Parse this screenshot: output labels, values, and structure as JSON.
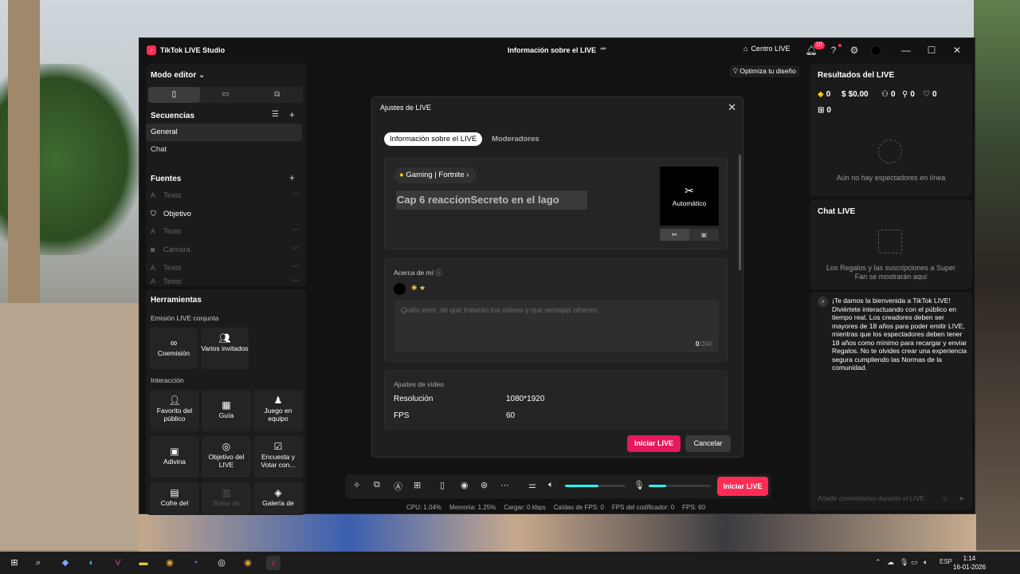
{
  "window": {
    "app_title": "TikTok LIVE Studio",
    "center_title": "Información sobre el LIVE",
    "centro_live": "Centro LIVE",
    "notif_count": "10"
  },
  "left": {
    "mode_editor": "Modo editor",
    "sequences_title": "Secuencias",
    "sequences": [
      "General",
      "Chat"
    ],
    "sources_title": "Fuentes",
    "sources": [
      "Texto",
      "Objetivo",
      "Texto",
      "Cámara",
      "Texto",
      "Texto"
    ],
    "tools_title": "Herramientas",
    "joint_title": "Emisión LIVE conjunta",
    "joint_tools": [
      "Coemisión",
      "Varios invitados"
    ],
    "interaction_title": "Interacción",
    "interaction_tools": [
      "Favorito del público",
      "Guía",
      "Juego en equipo",
      "Adivina",
      "Objetivo del LIVE",
      "Encuesta y Votar con...",
      "Cofre del",
      "Bolsa de",
      "Galería de"
    ]
  },
  "optimiza": "Optimiza tu diseño",
  "results": {
    "title": "Resultados del LIVE",
    "stats": [
      "0",
      "$0.00",
      "0",
      "0",
      "0",
      "0"
    ],
    "empty_text": "Aún no hay espectadores en línea"
  },
  "chat": {
    "title": "Chat LIVE",
    "empty_text": "Los Regalos y las suscripciones a Super Fan se mostrarán aquí",
    "welcome": "¡Te damos la bienvenida a TikTok LIVE! Diviértete interactuando con el público en tiempo real. Los creadores deben ser mayores de 18 años para poder emitir LIVE, mientras que los espectadores deben tener 18 años como mínimo para recargar y enviar Regalos. No te olvides crear una experiencia segura cumpliendo las Normas de la comunidad.",
    "comment_placeholder": "Añadir comentarios durante el LIVE"
  },
  "modal": {
    "title": "Ajustes de LIVE",
    "tab_info": "Información sobre el LIVE",
    "tab_mods": "Moderadores",
    "category": "Gaming | Fortnite",
    "live_title": "Cap 6 reaccionSecreto en el lago",
    "thumb_label": "Automático",
    "about_label": "Acerca de mí",
    "bio_placeholder": "Quién eres, de qué tratarán tus vídeos y qué ventajas ofreces",
    "bio_count": "0",
    "bio_max": "/240",
    "video_settings": "Ajustes de vídeo",
    "resolution_label": "Resolución",
    "resolution_value": "1080*1920",
    "fps_label": "FPS",
    "fps_value": "60",
    "start_button": "Iniciar LIVE",
    "cancel_button": "Cancelar"
  },
  "toolbar": {
    "start_button": "Iniciar LIVE",
    "speaker_level": 0.55,
    "mic_level": 0.28
  },
  "statusbar": {
    "cpu": "CPU: 1.04%",
    "memory": "Memoria: 1.25%",
    "load": "Cargar: 0 kbps",
    "fps_drops": "Caídas de FPS: 0",
    "encoder_fps": "FPS del codificador: 0",
    "fps": "FPS: 60"
  },
  "taskbar": {
    "lang": "ESP",
    "time": "1:14",
    "date": "16-01-2026"
  }
}
